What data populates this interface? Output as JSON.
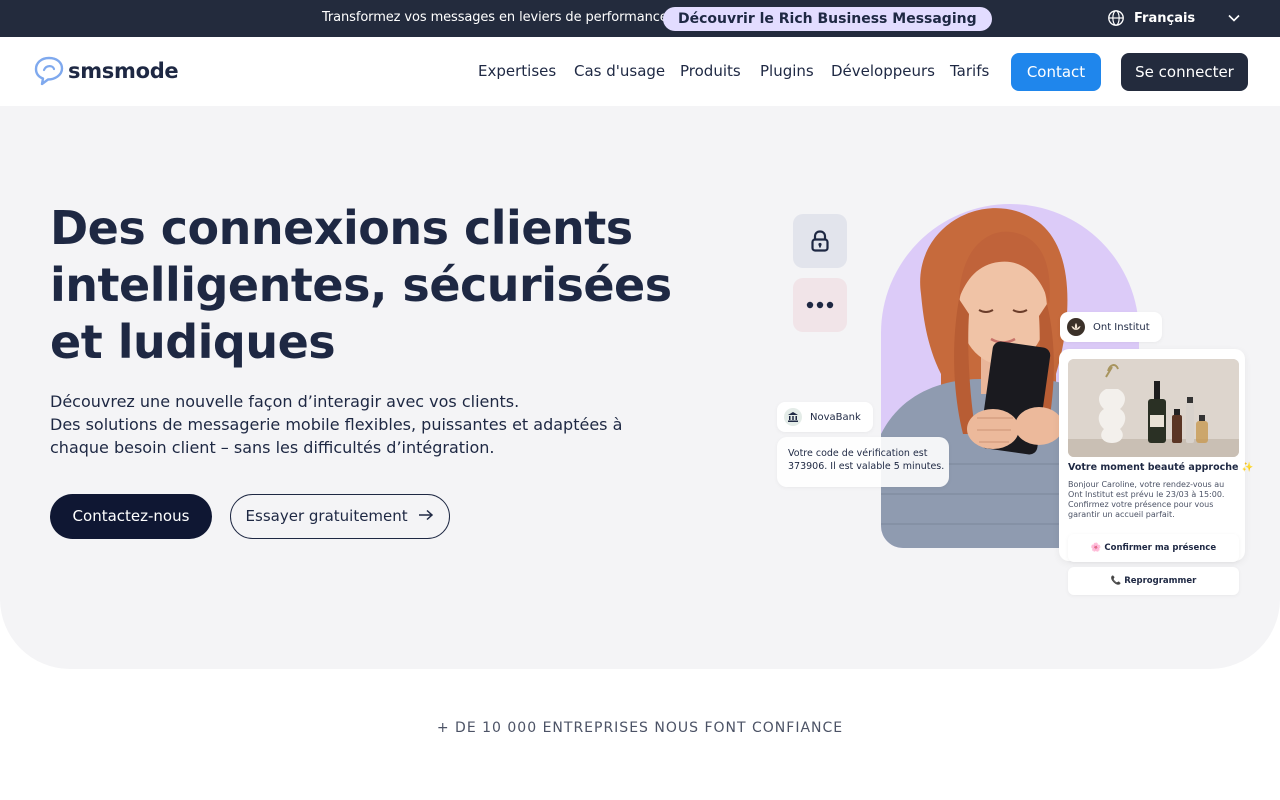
{
  "topbar": {
    "message": "Transformez vos messages en leviers de performance",
    "cta": "Découvrir le Rich Business Messaging",
    "language": "Français",
    "globe_icon": "globe-icon",
    "chevron_icon": "chevron-down-icon"
  },
  "header": {
    "logo_text": "smsmode",
    "nav": [
      "Expertises",
      "Cas d'usage",
      "Produits",
      "Plugins",
      "Développeurs",
      "Tarifs"
    ],
    "contact_label": "Contact",
    "login_label": "Se connecter"
  },
  "hero": {
    "title_lines": [
      "Des connexions clients",
      "intelligentes, sécurisées",
      "et ludiques"
    ],
    "subtitle_lines": [
      "Découvrez une nouvelle façon d’interagir avec vos clients.",
      "Des solutions de messagerie mobile flexibles, puissantes et adaptées à",
      "chaque besoin client – sans les difficultés d’intégration."
    ],
    "primary_cta": "Contactez-nous",
    "secondary_cta": "Essayer gratuitement",
    "secondary_cta_icon": "arrow-right-icon"
  },
  "visual": {
    "lock_icon": "lock-icon",
    "dots_icon": "more-dots-icon",
    "nova_chip": "NovaBank",
    "nova_message_lines": [
      "Votre code de vérification est",
      "373906. Il est valable 5 minutes."
    ],
    "ont_chip": "Ont Institut",
    "rich_card_title": "Votre moment beauté approche ✨",
    "rich_card_lines": [
      "Bonjour Caroline, votre rendez-vous au",
      "Ont Institut est prévu le 23/03 à 15:00.",
      "Confirmez votre présence pour vous",
      "garantir un accueil parfait."
    ],
    "rich_btn_confirm": "🌸 Confirmer ma présence",
    "rich_btn_reschedule": "📞 Reprogrammer"
  },
  "trust": {
    "text": "+ DE 10 000 ENTREPRISES NOUS FONT CONFIANCE"
  },
  "colors": {
    "dark_navy": "#232b3d",
    "primary_blue": "#1f86ec",
    "lavender": "#e2dcff",
    "hero_bg": "#f4f4f6",
    "arch_purple": "#dccbf8"
  }
}
